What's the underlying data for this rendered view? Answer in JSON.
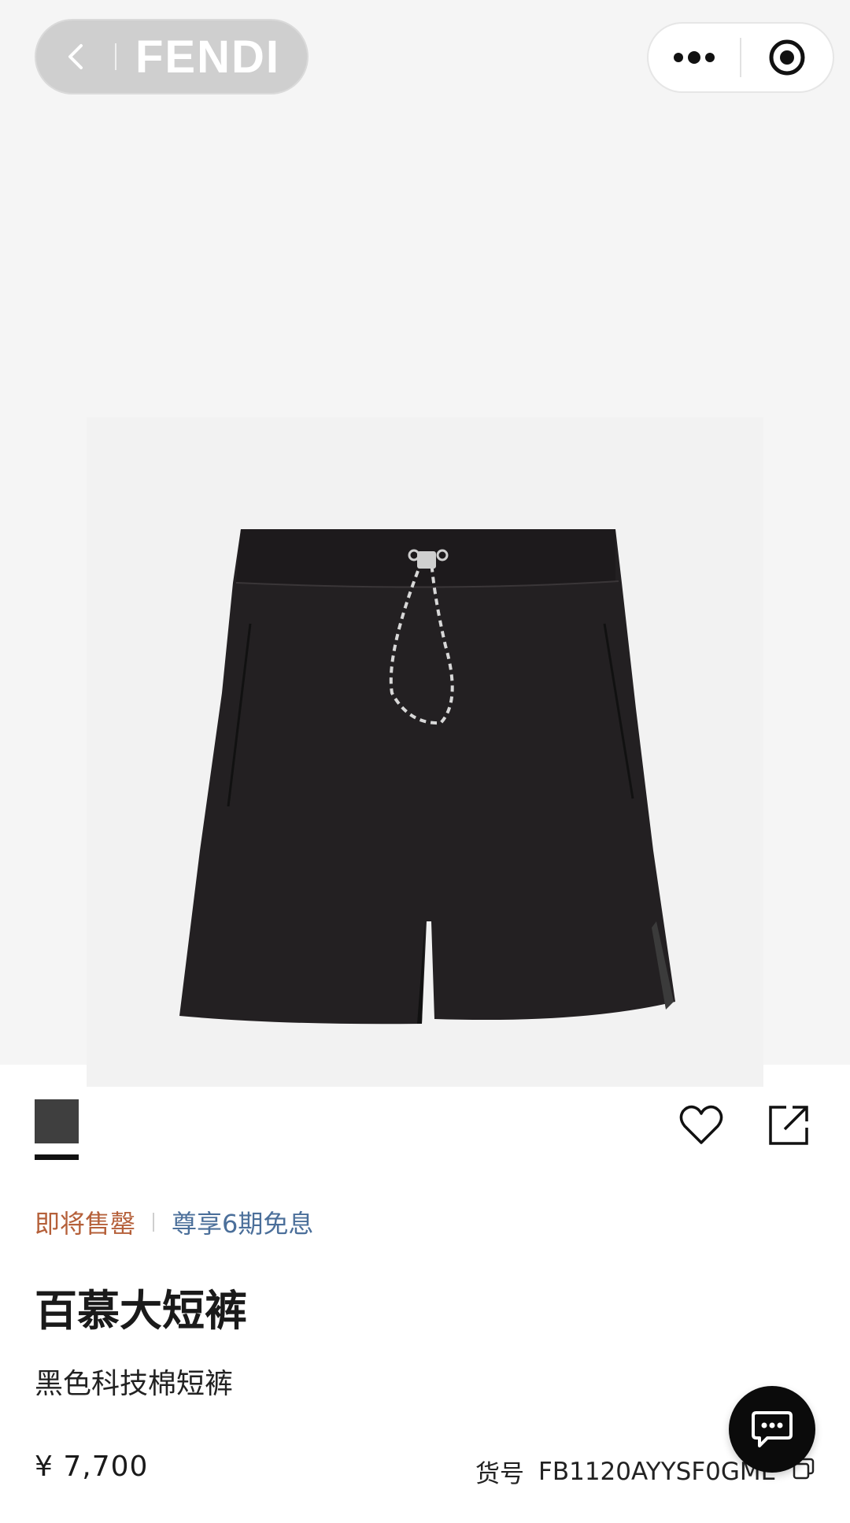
{
  "nav": {
    "brand": "FENDI"
  },
  "product": {
    "image_alt": "black shorts",
    "color_swatch": "#3f3f3f",
    "tag_soon": "即将售罄",
    "tag_installment": "尊享6期免息",
    "title": "百慕大短裤",
    "subtitle": "黑色科技棉短裤",
    "price": "¥ 7,700",
    "sku_label": "货号",
    "sku_value": "FB1120AYYSF0GME"
  },
  "icons": {
    "back": "chevron-left-icon",
    "more": "more-dots-icon",
    "close": "target-circle-icon",
    "favorite": "heart-icon",
    "share": "share-icon",
    "copy": "copy-icon",
    "chat": "chat-icon"
  },
  "colors": {
    "soon_tag": "#b5603a",
    "installment_tag": "#4b6f9a",
    "chat_button": "#0b0b0b"
  }
}
